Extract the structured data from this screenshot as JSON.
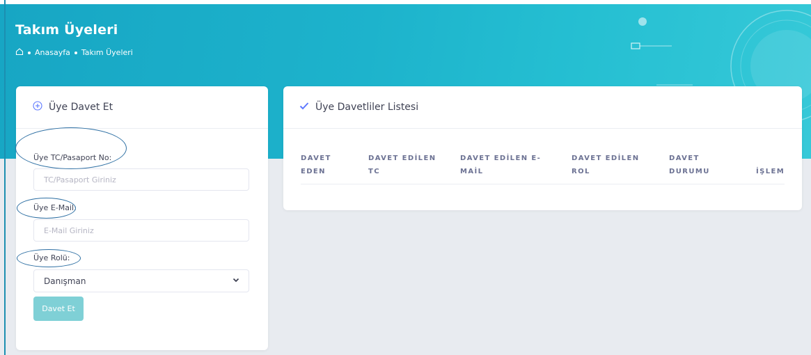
{
  "header": {
    "title": "Takım Üyeleri",
    "breadcrumb": {
      "home": "Anasayfa",
      "current": "Takım Üyeleri"
    }
  },
  "invite_card": {
    "title": "Üye Davet Et",
    "tc_label": "Üye TC/Pasaport No:",
    "tc_placeholder": "TC/Pasaport Giriniz",
    "email_label": "Üye E-Mail:",
    "email_placeholder": "E-Mail Giriniz",
    "role_label": "Üye Rolü:",
    "role_selected": "Danışman",
    "submit_label": "Davet Et"
  },
  "list_card": {
    "title": "Üye Davetliler Listesi",
    "columns": [
      {
        "line1": "DAVET",
        "line2": "EDEN"
      },
      {
        "line1": "DAVET EDİLEN",
        "line2": "TC"
      },
      {
        "line1": "DAVET EDİLEN E-",
        "line2": "MAİL"
      },
      {
        "line1": "DAVET EDİLEN",
        "line2": "ROL"
      },
      {
        "line1": "DAVET",
        "line2": "DURUMU"
      },
      {
        "line1": "",
        "line2": "İŞLEM"
      }
    ]
  },
  "colors": {
    "header_bg": "#1db3cc",
    "accent": "#2d6fa3",
    "button_bg": "#7fd0d6",
    "page_bg": "#e8ebf0"
  },
  "icons": {
    "home": "home-icon",
    "add": "plus-circle-icon",
    "check": "check-icon",
    "dropdown": "chevron-down-icon"
  }
}
